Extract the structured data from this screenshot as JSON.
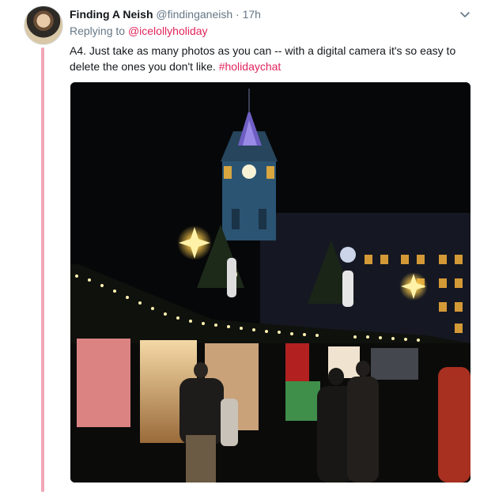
{
  "tweet": {
    "display_name": "Finding A Neish",
    "handle": "@findinganeish",
    "separator": "·",
    "time": "17h",
    "reply_prefix": "Replying to",
    "reply_handle": "@icelollyholiday",
    "text": "A4. Just take as many photos as you can -- with a digital camera it's so easy to delete the ones you don't like.",
    "hashtag": "#holidaychat"
  },
  "colors": {
    "accent": "#e0245e",
    "thread_line": "#f1a6b8",
    "secondary_text": "#657786",
    "primary_text": "#14171a"
  },
  "icons": {
    "menu": "chevron-down-icon"
  }
}
